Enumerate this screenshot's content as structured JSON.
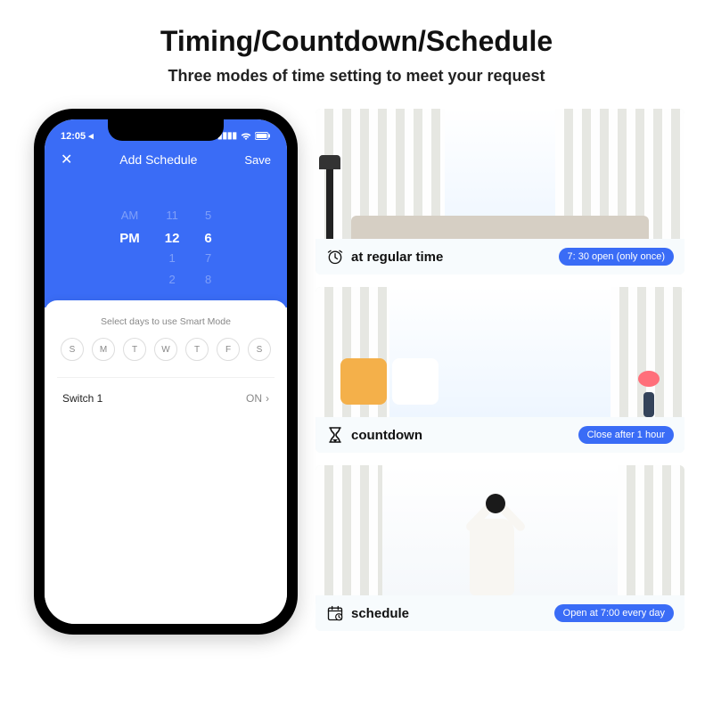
{
  "headline": "Timing/Countdown/Schedule",
  "subhead": "Three modes of time setting to meet your request",
  "phone": {
    "status_time": "12:05",
    "nav": {
      "close": "✕",
      "title": "Add Schedule",
      "save": "Save"
    },
    "picker": {
      "col1": [
        "",
        "AM",
        "PM",
        "",
        ""
      ],
      "col2": [
        "",
        "11",
        "12",
        "1",
        "2"
      ],
      "col3": [
        "",
        "5",
        "6",
        "7",
        "8"
      ],
      "selected_index": 2
    },
    "smart_label": "Select days to use Smart Mode",
    "days": [
      "S",
      "M",
      "T",
      "W",
      "T",
      "F",
      "S"
    ],
    "switch": {
      "label": "Switch 1",
      "value": "ON"
    }
  },
  "cards": [
    {
      "title": "at regular time",
      "badge": "7: 30 open (only once)",
      "icon": "clock"
    },
    {
      "title": "countdown",
      "badge": "Close after 1 hour",
      "icon": "hourglass"
    },
    {
      "title": "schedule",
      "badge": "Open at 7:00 every day",
      "icon": "calendar"
    }
  ]
}
